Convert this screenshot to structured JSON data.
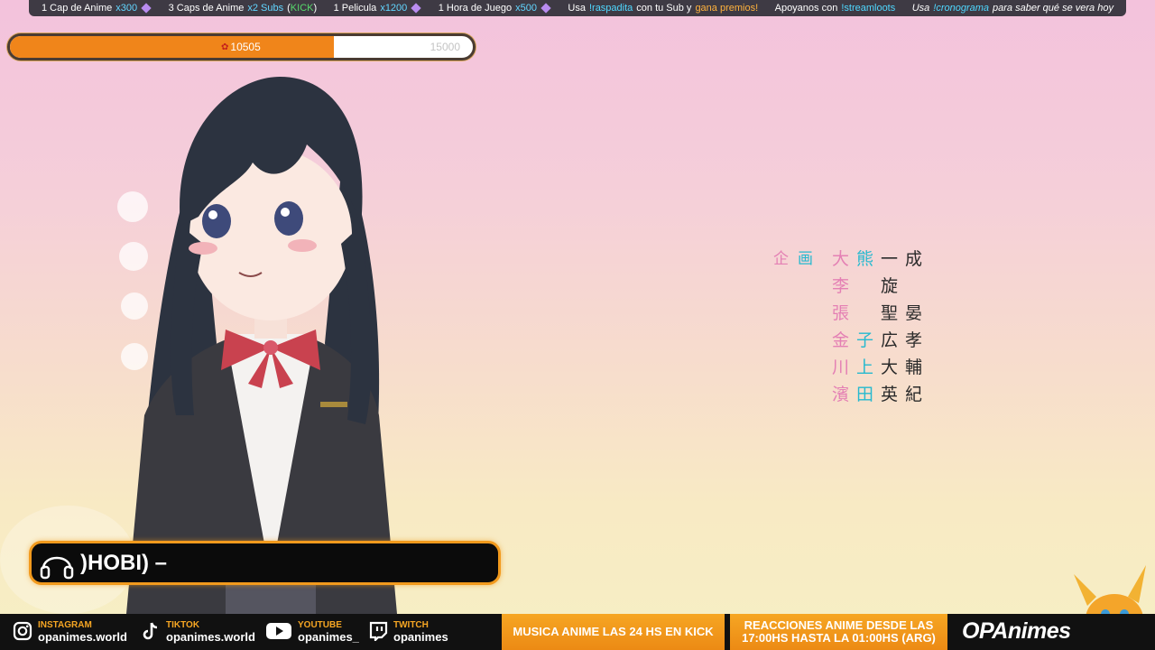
{
  "ticker": {
    "item1_text": "1 Cap de Anime",
    "item1_value": "x300",
    "item2_text": "3 Caps de Anime",
    "item2_value": "x2 Subs",
    "item2_extra_open": "(",
    "item2_extra": "KICK",
    "item2_extra_close": ")",
    "item3_text": "1 Pelicula",
    "item3_value": "x1200",
    "item4_text": "1 Hora de Juego",
    "item4_value": "x500",
    "item5_a": "Usa",
    "item5_cmd": "!raspadita",
    "item5_b": "con tu Sub y",
    "item5_c": "gana premios!",
    "item6_a": "Apoyanos con",
    "item6_cmd": "!streamloots",
    "item7_a": "Usa",
    "item7_cmd": "!cronograma",
    "item7_b": "para saber qué se vera hoy"
  },
  "goal": {
    "current": "10505",
    "target": "15000",
    "progress_fraction": 0.7003,
    "fill_color": "#f0851a"
  },
  "credits": {
    "role": [
      "企",
      "画"
    ],
    "rows": [
      [
        "大",
        "熊",
        "一",
        "成"
      ],
      [
        "李",
        "",
        "旋",
        ""
      ],
      [
        "張",
        "",
        "聖",
        "晏"
      ],
      [
        "金",
        "子",
        "広",
        "孝"
      ],
      [
        "川",
        "上",
        "大",
        "輔"
      ],
      [
        "濱",
        "田",
        "英",
        "紀"
      ]
    ]
  },
  "now_playing": {
    "icon": "headphones-icon",
    "song": ")HOBI) –"
  },
  "socials": [
    {
      "platform": "INSTAGRAM",
      "handle": "opanimes.world",
      "icon": "instagram-icon"
    },
    {
      "platform": "TIKTOK",
      "handle": "opanimes.world",
      "icon": "tiktok-icon"
    },
    {
      "platform": "YOUTUBE",
      "handle": "opanimes_",
      "icon": "youtube-icon"
    },
    {
      "platform": "TWITCH",
      "handle": "opanimes",
      "icon": "twitch-icon"
    }
  ],
  "promos": {
    "kick": "MUSICA ANIME LAS 24 HS EN KICK",
    "reactions_line1": "REACCIONES ANIME DESDE LAS",
    "reactions_line2": "17:00HS HASTA LA 01:00HS (ARG)"
  },
  "brand": "OPAnimes",
  "colors": {
    "accent": "#f29a1d",
    "ticker_bg": "#3e3a44",
    "credit_pink": "#e480b4",
    "credit_cyan": "#26b9cf"
  }
}
